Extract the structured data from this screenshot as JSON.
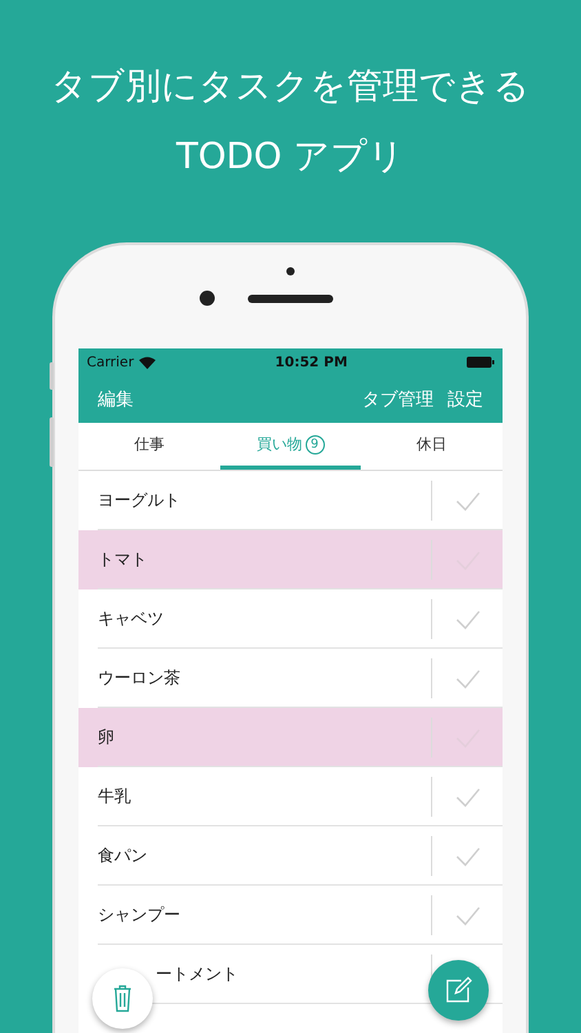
{
  "headline": [
    "タブ別にタスクを管理できる",
    "TODO アプリ"
  ],
  "status_bar": {
    "carrier": "Carrier",
    "time": "10:52 PM"
  },
  "nav_bar": {
    "left": "編集",
    "right": [
      "タブ管理",
      "設定"
    ]
  },
  "tabs": [
    {
      "label": "仕事",
      "selected": false
    },
    {
      "label": "買い物",
      "badge": "9",
      "selected": true
    },
    {
      "label": "休日",
      "selected": false
    }
  ],
  "tasks": [
    {
      "text": "ヨーグルト",
      "highlighted": false,
      "kind": "full"
    },
    {
      "text": "トマト",
      "highlighted": true,
      "kind": "full"
    },
    {
      "text": "キャベツ",
      "highlighted": false,
      "kind": "full"
    },
    {
      "text": "ウーロン茶",
      "highlighted": false,
      "kind": "full"
    },
    {
      "text": "卵",
      "highlighted": true,
      "kind": "full"
    },
    {
      "text": "牛乳",
      "highlighted": false,
      "kind": "full"
    },
    {
      "text": "食パン",
      "highlighted": false,
      "kind": "full"
    },
    {
      "text": "シャンプー",
      "highlighted": false,
      "kind": "full"
    },
    {
      "text": "ートメント",
      "highlighted": false,
      "kind": "covered"
    }
  ]
}
